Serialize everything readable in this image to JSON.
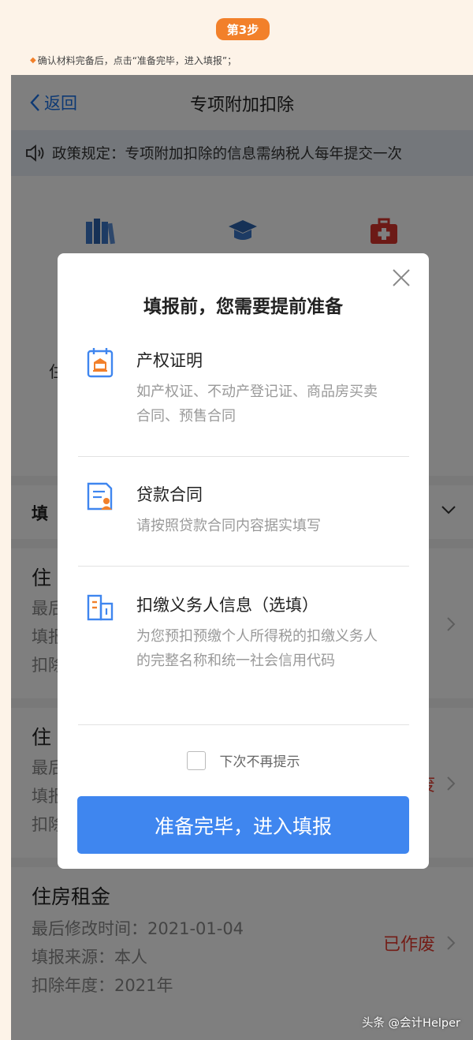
{
  "tutorial": {
    "step_badge": "第3步",
    "instruction": "确认材料完备后，点击“准备完毕，进入填报”；"
  },
  "nav": {
    "back_label": "返回",
    "title": "专项附加扣除"
  },
  "policy_notice": "政策规定：专项附加扣除的信息需纳税人每年提交一次",
  "background": {
    "category_partial_label": "住",
    "section_header_partial": "填",
    "records": [
      {
        "title": "住",
        "l1": "最后",
        "l2": "填报",
        "l3": "扣除",
        "status": ""
      },
      {
        "title": "住",
        "l1": "最后",
        "l2": "填报",
        "l3": "扣除",
        "status": "废"
      },
      {
        "title": "住房租金",
        "l1": "最后修改时间：2021-01-04",
        "l2": "填报来源：本人",
        "l3": "扣除年度：2021年",
        "status": "已作废"
      }
    ]
  },
  "dialog": {
    "title": "填报前，您需要提前准备",
    "items": [
      {
        "icon": "property-certificate-icon",
        "heading": "产权证明",
        "desc": "如产权证、不动产登记证、商品房买卖合同、预售合同"
      },
      {
        "icon": "loan-contract-icon",
        "heading": "贷款合同",
        "desc": "请按照贷款合同内容据实填写"
      },
      {
        "icon": "withholding-agent-icon",
        "heading": "扣缴义务人信息（选填）",
        "desc": "为您预扣预缴个人所得税的扣缴义务人的完整名称和统一社会信用代码"
      }
    ],
    "checkbox_label": "下次不再提示",
    "confirm_button": "准备完毕，进入填报"
  },
  "watermark": "头条 @会计Helper",
  "colors": {
    "accent": "#3f86ef",
    "badge": "#f2802a",
    "void_status": "#e63b2e"
  }
}
